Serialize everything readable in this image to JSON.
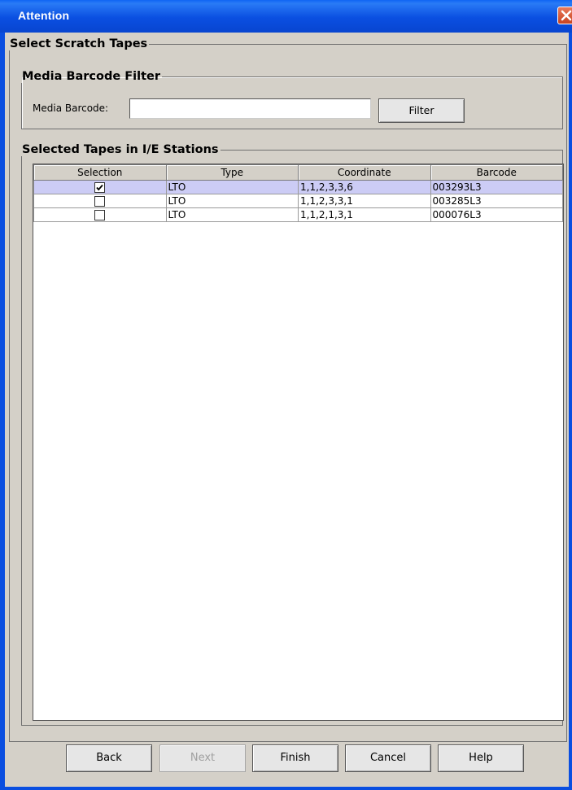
{
  "window": {
    "title": "Attention"
  },
  "sections": {
    "scratch": "Select Scratch Tapes",
    "filter": "Media Barcode Filter",
    "tapes": "Selected Tapes in I/E Stations"
  },
  "filter": {
    "label": "Media Barcode:",
    "value": "",
    "button": "Filter"
  },
  "table": {
    "columns": [
      "Selection",
      "Type",
      "Coordinate",
      "Barcode"
    ],
    "rows": [
      {
        "selected": true,
        "type": "LTO",
        "coordinate": "1,1,2,3,3,6",
        "barcode": "003293L3"
      },
      {
        "selected": false,
        "type": "LTO",
        "coordinate": "1,1,2,3,3,1",
        "barcode": "003285L3"
      },
      {
        "selected": false,
        "type": "LTO",
        "coordinate": "1,1,2,1,3,1",
        "barcode": "000076L3"
      }
    ]
  },
  "buttons": {
    "back": "Back",
    "next": "Next",
    "finish": "Finish",
    "cancel": "Cancel",
    "help": "Help"
  },
  "colors": {
    "title_bar": "#0a4fe1",
    "dialog_bg": "#d4d0c8",
    "row_highlight": "#ccccf5",
    "close": "#c9431f"
  }
}
